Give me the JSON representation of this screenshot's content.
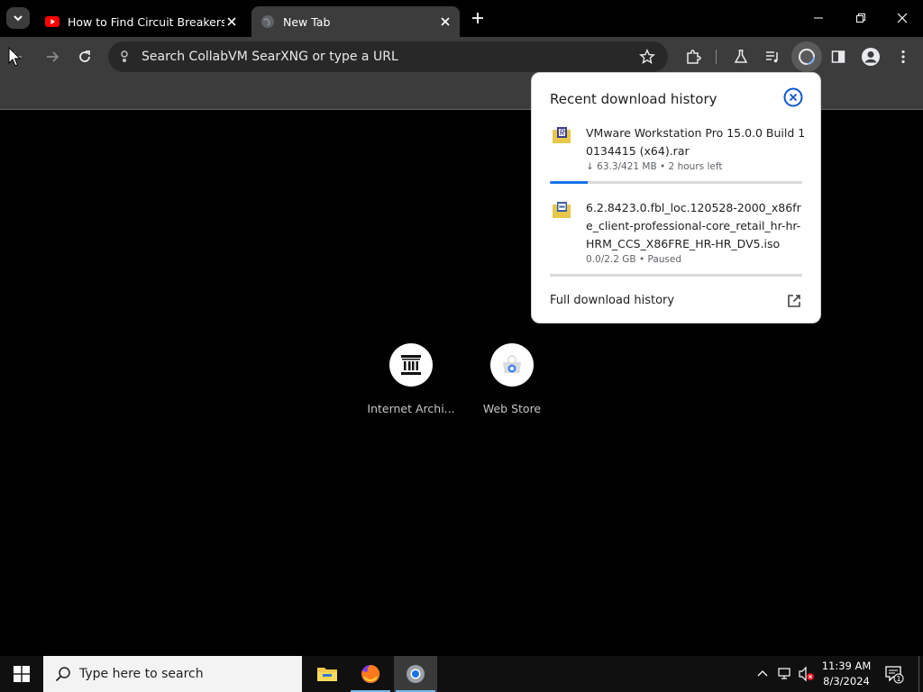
{
  "tabs": [
    {
      "title": "How to Find Circuit Breakers /",
      "favicon": "youtube-icon",
      "active": false
    },
    {
      "title": "New Tab",
      "favicon": "globe-icon",
      "active": true
    }
  ],
  "toolbar": {
    "omnibox_placeholder": "Search CollabVM SearXNG or type a URL"
  },
  "shortcuts": [
    {
      "label": "Internet Archi...",
      "icon": "archive-icon"
    },
    {
      "label": "Web Store",
      "icon": "webstore-icon"
    }
  ],
  "download_bubble": {
    "title": "Recent download history",
    "items": [
      {
        "name": "VMware Workstation Pro 15.0.0 Build 10134415 (x64).rar",
        "status": "↓ 63.3/421 MB • 2 hours left",
        "progress": 0.15,
        "icon": "rar-archive-icon"
      },
      {
        "name": "6.2.8423.0.fbl_loc.120528-2000_x86fre_client-professional-core_retail_hr-hr-HRM_CCS_X86FRE_HR-HR_DV5.iso",
        "status": "0.0/2.2 GB • Paused",
        "progress": 0.0,
        "icon": "iso-disc-icon"
      }
    ],
    "footer_link": "Full download history"
  },
  "taskbar": {
    "search_placeholder": "Type here to search",
    "time": "11:39 AM",
    "date": "8/3/2024",
    "notification_count": "1"
  },
  "colors": {
    "page_bg": "#000000",
    "toolbar_bg": "#3c3c3c",
    "omnibox_bg": "#282828",
    "progress_fill": "#1a73e8",
    "taskbar_bg": "#101010"
  }
}
